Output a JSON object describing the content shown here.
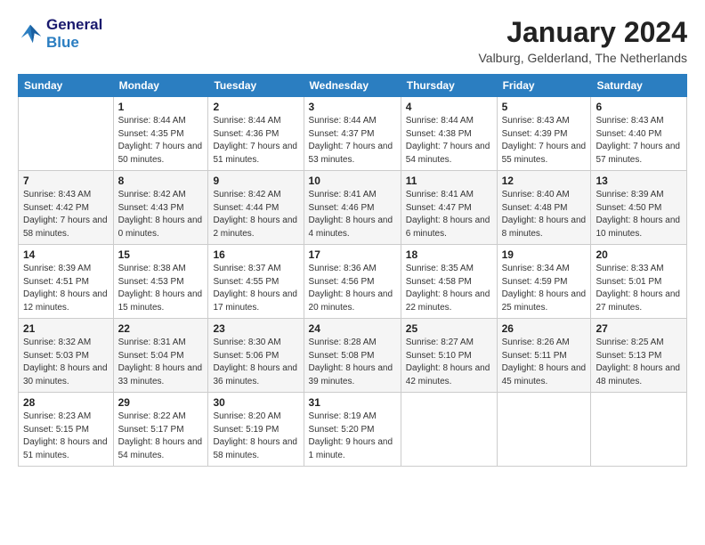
{
  "logo": {
    "line1": "General",
    "line2": "Blue"
  },
  "header": {
    "title": "January 2024",
    "subtitle": "Valburg, Gelderland, The Netherlands"
  },
  "weekdays": [
    "Sunday",
    "Monday",
    "Tuesday",
    "Wednesday",
    "Thursday",
    "Friday",
    "Saturday"
  ],
  "weeks": [
    [
      {
        "day": "",
        "sunrise": "",
        "sunset": "",
        "daylight": ""
      },
      {
        "day": "1",
        "sunrise": "Sunrise: 8:44 AM",
        "sunset": "Sunset: 4:35 PM",
        "daylight": "Daylight: 7 hours and 50 minutes."
      },
      {
        "day": "2",
        "sunrise": "Sunrise: 8:44 AM",
        "sunset": "Sunset: 4:36 PM",
        "daylight": "Daylight: 7 hours and 51 minutes."
      },
      {
        "day": "3",
        "sunrise": "Sunrise: 8:44 AM",
        "sunset": "Sunset: 4:37 PM",
        "daylight": "Daylight: 7 hours and 53 minutes."
      },
      {
        "day": "4",
        "sunrise": "Sunrise: 8:44 AM",
        "sunset": "Sunset: 4:38 PM",
        "daylight": "Daylight: 7 hours and 54 minutes."
      },
      {
        "day": "5",
        "sunrise": "Sunrise: 8:43 AM",
        "sunset": "Sunset: 4:39 PM",
        "daylight": "Daylight: 7 hours and 55 minutes."
      },
      {
        "day": "6",
        "sunrise": "Sunrise: 8:43 AM",
        "sunset": "Sunset: 4:40 PM",
        "daylight": "Daylight: 7 hours and 57 minutes."
      }
    ],
    [
      {
        "day": "7",
        "sunrise": "Sunrise: 8:43 AM",
        "sunset": "Sunset: 4:42 PM",
        "daylight": "Daylight: 7 hours and 58 minutes."
      },
      {
        "day": "8",
        "sunrise": "Sunrise: 8:42 AM",
        "sunset": "Sunset: 4:43 PM",
        "daylight": "Daylight: 8 hours and 0 minutes."
      },
      {
        "day": "9",
        "sunrise": "Sunrise: 8:42 AM",
        "sunset": "Sunset: 4:44 PM",
        "daylight": "Daylight: 8 hours and 2 minutes."
      },
      {
        "day": "10",
        "sunrise": "Sunrise: 8:41 AM",
        "sunset": "Sunset: 4:46 PM",
        "daylight": "Daylight: 8 hours and 4 minutes."
      },
      {
        "day": "11",
        "sunrise": "Sunrise: 8:41 AM",
        "sunset": "Sunset: 4:47 PM",
        "daylight": "Daylight: 8 hours and 6 minutes."
      },
      {
        "day": "12",
        "sunrise": "Sunrise: 8:40 AM",
        "sunset": "Sunset: 4:48 PM",
        "daylight": "Daylight: 8 hours and 8 minutes."
      },
      {
        "day": "13",
        "sunrise": "Sunrise: 8:39 AM",
        "sunset": "Sunset: 4:50 PM",
        "daylight": "Daylight: 8 hours and 10 minutes."
      }
    ],
    [
      {
        "day": "14",
        "sunrise": "Sunrise: 8:39 AM",
        "sunset": "Sunset: 4:51 PM",
        "daylight": "Daylight: 8 hours and 12 minutes."
      },
      {
        "day": "15",
        "sunrise": "Sunrise: 8:38 AM",
        "sunset": "Sunset: 4:53 PM",
        "daylight": "Daylight: 8 hours and 15 minutes."
      },
      {
        "day": "16",
        "sunrise": "Sunrise: 8:37 AM",
        "sunset": "Sunset: 4:55 PM",
        "daylight": "Daylight: 8 hours and 17 minutes."
      },
      {
        "day": "17",
        "sunrise": "Sunrise: 8:36 AM",
        "sunset": "Sunset: 4:56 PM",
        "daylight": "Daylight: 8 hours and 20 minutes."
      },
      {
        "day": "18",
        "sunrise": "Sunrise: 8:35 AM",
        "sunset": "Sunset: 4:58 PM",
        "daylight": "Daylight: 8 hours and 22 minutes."
      },
      {
        "day": "19",
        "sunrise": "Sunrise: 8:34 AM",
        "sunset": "Sunset: 4:59 PM",
        "daylight": "Daylight: 8 hours and 25 minutes."
      },
      {
        "day": "20",
        "sunrise": "Sunrise: 8:33 AM",
        "sunset": "Sunset: 5:01 PM",
        "daylight": "Daylight: 8 hours and 27 minutes."
      }
    ],
    [
      {
        "day": "21",
        "sunrise": "Sunrise: 8:32 AM",
        "sunset": "Sunset: 5:03 PM",
        "daylight": "Daylight: 8 hours and 30 minutes."
      },
      {
        "day": "22",
        "sunrise": "Sunrise: 8:31 AM",
        "sunset": "Sunset: 5:04 PM",
        "daylight": "Daylight: 8 hours and 33 minutes."
      },
      {
        "day": "23",
        "sunrise": "Sunrise: 8:30 AM",
        "sunset": "Sunset: 5:06 PM",
        "daylight": "Daylight: 8 hours and 36 minutes."
      },
      {
        "day": "24",
        "sunrise": "Sunrise: 8:28 AM",
        "sunset": "Sunset: 5:08 PM",
        "daylight": "Daylight: 8 hours and 39 minutes."
      },
      {
        "day": "25",
        "sunrise": "Sunrise: 8:27 AM",
        "sunset": "Sunset: 5:10 PM",
        "daylight": "Daylight: 8 hours and 42 minutes."
      },
      {
        "day": "26",
        "sunrise": "Sunrise: 8:26 AM",
        "sunset": "Sunset: 5:11 PM",
        "daylight": "Daylight: 8 hours and 45 minutes."
      },
      {
        "day": "27",
        "sunrise": "Sunrise: 8:25 AM",
        "sunset": "Sunset: 5:13 PM",
        "daylight": "Daylight: 8 hours and 48 minutes."
      }
    ],
    [
      {
        "day": "28",
        "sunrise": "Sunrise: 8:23 AM",
        "sunset": "Sunset: 5:15 PM",
        "daylight": "Daylight: 8 hours and 51 minutes."
      },
      {
        "day": "29",
        "sunrise": "Sunrise: 8:22 AM",
        "sunset": "Sunset: 5:17 PM",
        "daylight": "Daylight: 8 hours and 54 minutes."
      },
      {
        "day": "30",
        "sunrise": "Sunrise: 8:20 AM",
        "sunset": "Sunset: 5:19 PM",
        "daylight": "Daylight: 8 hours and 58 minutes."
      },
      {
        "day": "31",
        "sunrise": "Sunrise: 8:19 AM",
        "sunset": "Sunset: 5:20 PM",
        "daylight": "Daylight: 9 hours and 1 minute."
      },
      {
        "day": "",
        "sunrise": "",
        "sunset": "",
        "daylight": ""
      },
      {
        "day": "",
        "sunrise": "",
        "sunset": "",
        "daylight": ""
      },
      {
        "day": "",
        "sunrise": "",
        "sunset": "",
        "daylight": ""
      }
    ]
  ]
}
